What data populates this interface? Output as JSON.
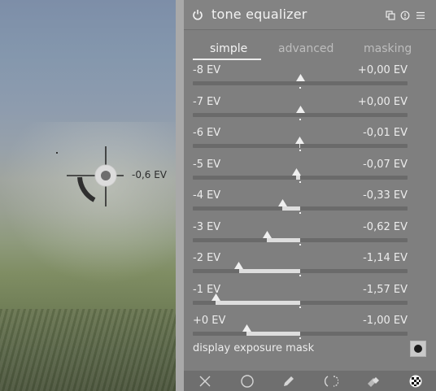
{
  "module": {
    "title": "tone equalizer",
    "header_icons": [
      "power-icon",
      "presets-icon",
      "reset-icon",
      "menu-icon"
    ]
  },
  "tabs": [
    {
      "label": "simple",
      "active": true
    },
    {
      "label": "advanced",
      "active": false
    },
    {
      "label": "masking",
      "active": false
    }
  ],
  "sliders": [
    {
      "label": "-8 EV",
      "value": "+0,00 EV",
      "ev": 0.0
    },
    {
      "label": "-7 EV",
      "value": "+0,00 EV",
      "ev": 0.0
    },
    {
      "label": "-6 EV",
      "value": "-0,01 EV",
      "ev": -0.01
    },
    {
      "label": "-5 EV",
      "value": "-0,07 EV",
      "ev": -0.07
    },
    {
      "label": "-4 EV",
      "value": "-0,33 EV",
      "ev": -0.33
    },
    {
      "label": "-3 EV",
      "value": "-0,62 EV",
      "ev": -0.62
    },
    {
      "label": "-2 EV",
      "value": "-1,14 EV",
      "ev": -1.14
    },
    {
      "label": "-1 EV",
      "value": "-1,57 EV",
      "ev": -1.57
    },
    {
      "label": "+0 EV",
      "value": "-1,00 EV",
      "ev": -1.0
    }
  ],
  "mask": {
    "label": "display exposure mask",
    "enabled": true
  },
  "preview": {
    "cursor_readout": "-0,6 EV"
  },
  "footer_icons": [
    "close-icon",
    "circle-icon",
    "pencil-icon",
    "mask-icon",
    "blend-icon",
    "checker-icon"
  ],
  "colors": {
    "panel": "#7f7f7f",
    "track": "#6a6a6a",
    "fill": "#dedede",
    "text": "#ececec"
  }
}
